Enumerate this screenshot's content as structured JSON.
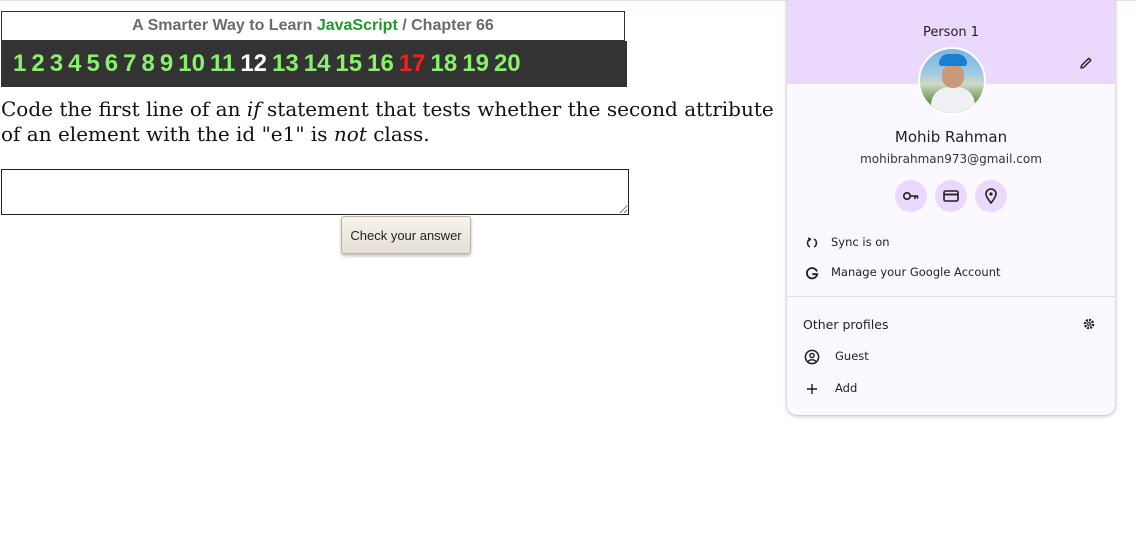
{
  "header": {
    "prefix": "A Smarter Way to Learn",
    "book": "JavaScript",
    "separator": "/",
    "chapter": "Chapter 66"
  },
  "chapters": [
    {
      "label": "1",
      "state": "done"
    },
    {
      "label": "2",
      "state": "done"
    },
    {
      "label": "3",
      "state": "done"
    },
    {
      "label": "4",
      "state": "done"
    },
    {
      "label": "5",
      "state": "done"
    },
    {
      "label": "6",
      "state": "done"
    },
    {
      "label": "7",
      "state": "done"
    },
    {
      "label": "8",
      "state": "done"
    },
    {
      "label": "9",
      "state": "done"
    },
    {
      "label": "10",
      "state": "done"
    },
    {
      "label": "11",
      "state": "done"
    },
    {
      "label": "12",
      "state": "current"
    },
    {
      "label": "13",
      "state": "done"
    },
    {
      "label": "14",
      "state": "done"
    },
    {
      "label": "15",
      "state": "done"
    },
    {
      "label": "16",
      "state": "done"
    },
    {
      "label": "17",
      "state": "wrong"
    },
    {
      "label": "18",
      "state": "done"
    },
    {
      "label": "19",
      "state": "done"
    },
    {
      "label": "20",
      "state": "done"
    }
  ],
  "question": {
    "part1": "Code the first line of an ",
    "em1": "if",
    "part2": " statement that tests whether the second attribute of an element with the id \"e1\" is ",
    "em2": "not",
    "part3": " class."
  },
  "answer": {
    "value": "",
    "button_label": "Check your answer"
  },
  "colors": {
    "accent_green": "#88f06a",
    "current": "#ffffff",
    "wrong": "#ff1a1a",
    "brand_green": "#1e9a2d"
  },
  "profile_menu": {
    "profile_label": "Person 1",
    "name": "Mohib Rahman",
    "email": "mohibrahman973@gmail.com",
    "quick_actions": [
      "key-icon",
      "credit-card-icon",
      "location-pin-icon"
    ],
    "sync_label": "Sync is on",
    "manage_label": "Manage your Google Account",
    "other_profiles_label": "Other profiles",
    "guest_label": "Guest",
    "add_label": "Add",
    "header_color": "#ead9fd"
  }
}
